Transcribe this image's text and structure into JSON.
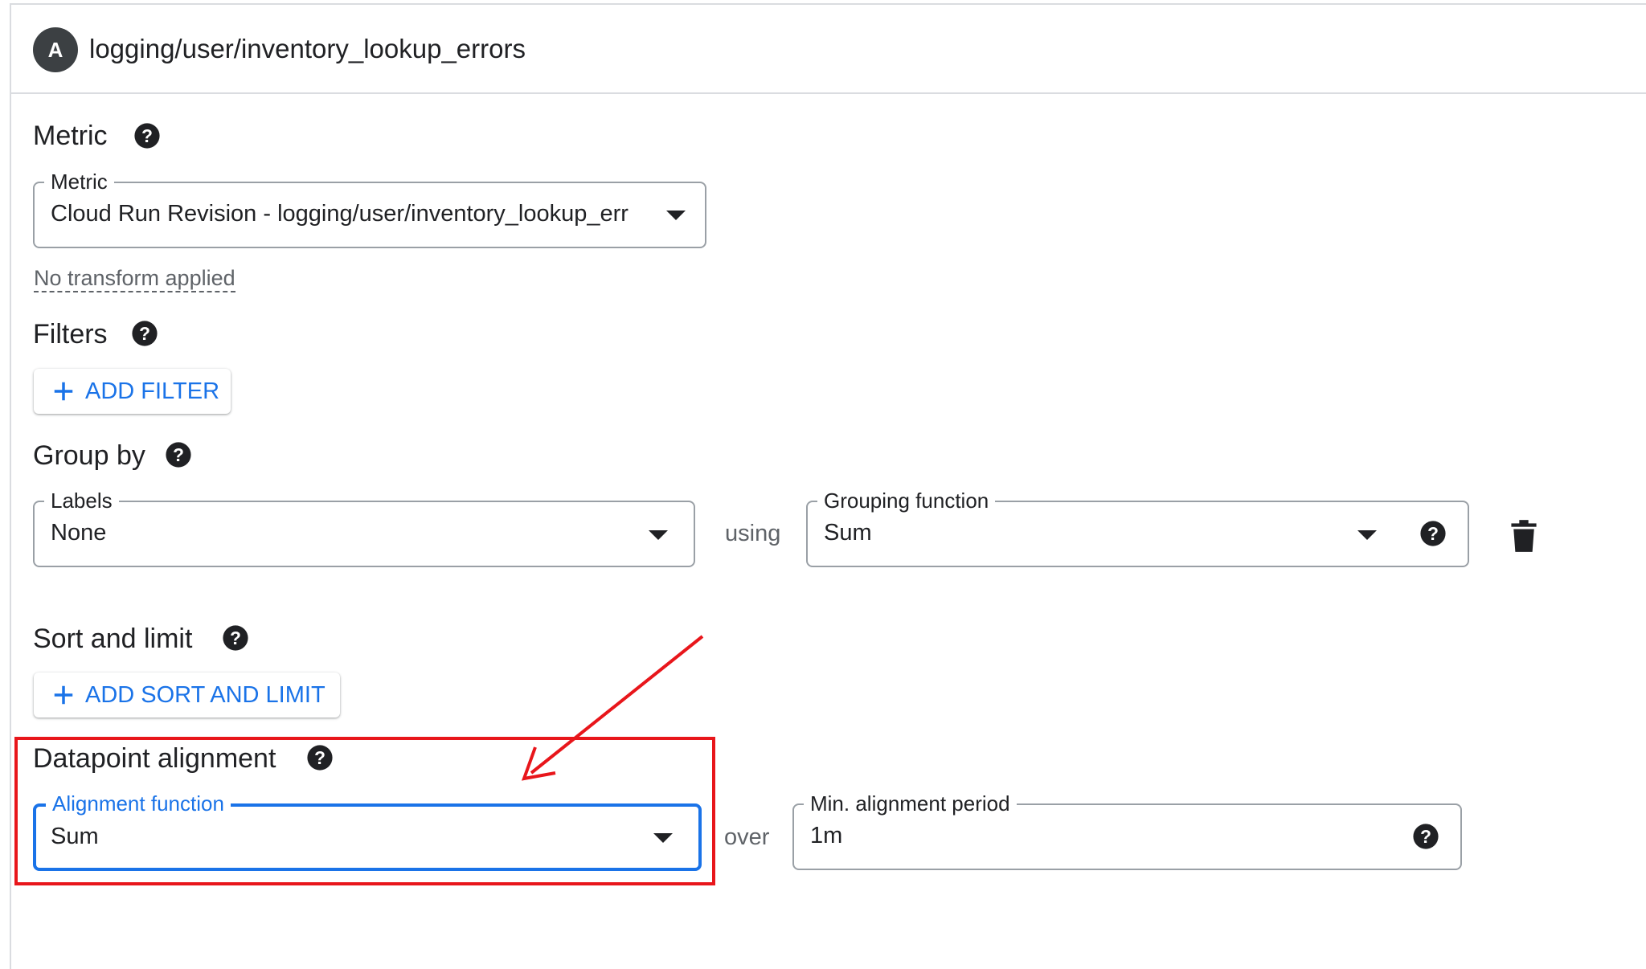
{
  "header": {
    "avatar_letter": "A",
    "title": "logging/user/inventory_lookup_errors"
  },
  "metric": {
    "section_title": "Metric",
    "field_label": "Metric",
    "value": "Cloud Run Revision - logging/user/inventory_lookup_err",
    "transform_link": "No transform applied"
  },
  "filters": {
    "section_title": "Filters",
    "add_button": "ADD FILTER"
  },
  "group_by": {
    "section_title": "Group by",
    "labels_label": "Labels",
    "labels_value": "None",
    "connector": "using",
    "grouping_label": "Grouping function",
    "grouping_value": "Sum"
  },
  "sort_limit": {
    "section_title": "Sort and limit",
    "add_button": "ADD SORT AND LIMIT"
  },
  "alignment": {
    "section_title": "Datapoint alignment",
    "function_label": "Alignment function",
    "function_value": "Sum",
    "connector": "over",
    "period_label": "Min. alignment period",
    "period_value": "1m"
  },
  "colors": {
    "accent": "#1a73e8",
    "annotation": "#e8161b",
    "text": "#202124",
    "border": "#9aa0a6"
  },
  "icons": [
    "help-icon",
    "chevron-down-icon",
    "plus-icon",
    "trash-icon",
    "arrow-annotation"
  ]
}
